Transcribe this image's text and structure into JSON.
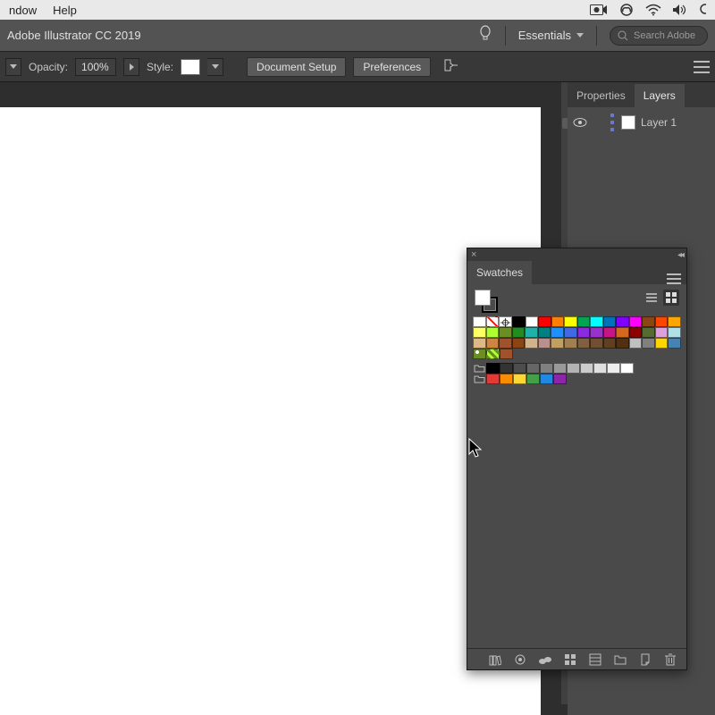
{
  "mac_menu": {
    "window": "ndow",
    "help": "Help"
  },
  "app": {
    "title": "Adobe Illustrator CC 2019",
    "workspace": "Essentials",
    "search_placeholder": "Search Adobe"
  },
  "options": {
    "opacity_label": "Opacity:",
    "opacity_value": "100%",
    "style_label": "Style:",
    "doc_setup": "Document Setup",
    "preferences": "Preferences"
  },
  "panels": {
    "properties": "Properties",
    "layers": "Layers",
    "layer1": "Layer 1"
  },
  "swatches": {
    "title": "Swatches",
    "rows": [
      [
        "#ffffff",
        "diag",
        "reg",
        "#000000",
        "#ffffff",
        "#ff0000",
        "#ff7f00",
        "#ffff00",
        "#00a651",
        "#00ffff",
        "#0072bc",
        "#7f00ff",
        "#ff00ff",
        "#8b4513",
        "#ff4500",
        "#ffa500"
      ],
      [
        "#ffff66",
        "#adff2f",
        "#6b8e23",
        "#228b22",
        "#20b2aa",
        "#008080",
        "#1e90ff",
        "#4169e1",
        "#8a2be2",
        "#9932cc",
        "#c71585",
        "#d2691e",
        "#8b0000",
        "#556b2f",
        "#dda0dd",
        "#b0e0e6"
      ],
      [
        "#deb887",
        "#cd853f",
        "#a0522d",
        "#8b4513",
        "#d2b48c",
        "#bc8f8f",
        "#c0a060",
        "#a08050",
        "#806040",
        "#705030",
        "#604020",
        "#503010",
        "#c0c0c0",
        "#808080",
        "#ffd700",
        "#4682b4"
      ],
      [
        "pat1",
        "pat2",
        "#a0522d"
      ],
      [
        "folder",
        "#000000",
        "#333333",
        "#4d4d4d",
        "#666666",
        "#808080",
        "#999999",
        "#b3b3b3",
        "#cccccc",
        "#e0e0e0",
        "#eeeeee",
        "#ffffff"
      ],
      [
        "folder",
        "#e53935",
        "#fb8c00",
        "#fdd835",
        "#43a047",
        "#1e88e5",
        "#8e24aa"
      ]
    ]
  }
}
